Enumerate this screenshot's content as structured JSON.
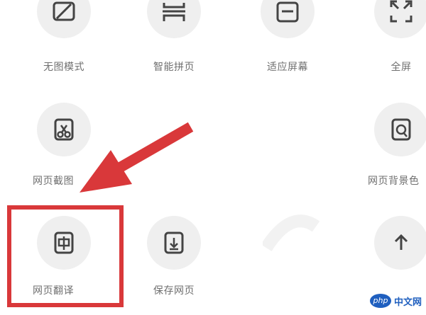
{
  "menu": {
    "items": [
      {
        "label": "无图模式",
        "icon": "no-image-icon"
      },
      {
        "label": "智能拼页",
        "icon": "smart-page-join-icon"
      },
      {
        "label": "适应屏幕",
        "icon": "fit-screen-icon"
      },
      {
        "label": "全屏",
        "icon": "fullscreen-icon"
      },
      {
        "label": "网页截图",
        "icon": "screenshot-icon"
      },
      {
        "label": "网页背景色",
        "icon": "background-color-icon"
      },
      {
        "label": "网页翻译",
        "icon": "translate-icon"
      },
      {
        "label": "保存网页",
        "icon": "save-page-icon"
      },
      {
        "label": "",
        "icon": "share-icon"
      }
    ]
  },
  "annotation": {
    "color": "#d9383a"
  },
  "watermark": {
    "badge": "php",
    "text": "中文网"
  }
}
